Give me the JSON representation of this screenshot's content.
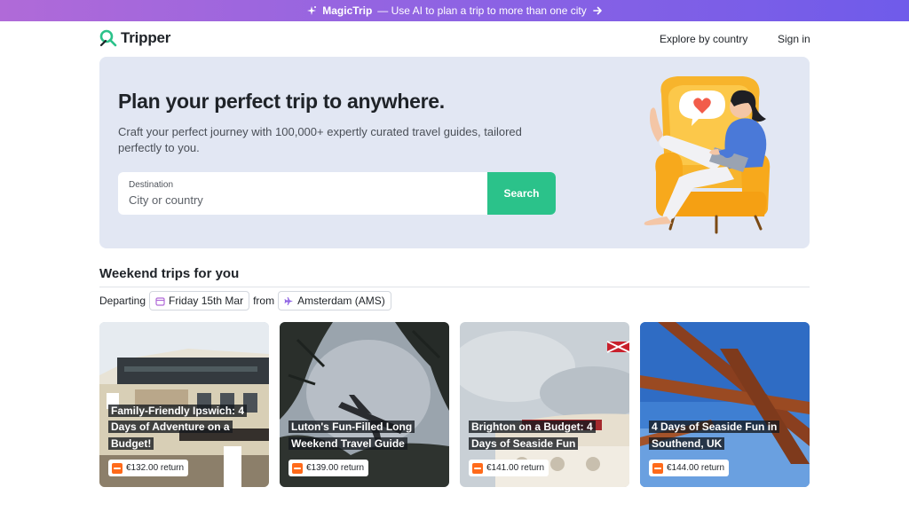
{
  "banner": {
    "brand": "MagicTrip",
    "text": "— Use AI to plan a trip to more than one city",
    "icon": "sparkle-icon",
    "arrow_icon": "arrow-right-icon"
  },
  "nav": {
    "logo": "Tripper",
    "explore": "Explore by country",
    "signin": "Sign in"
  },
  "hero": {
    "title": "Plan your perfect trip to anywhere.",
    "subtitle": "Craft your perfect journey with 100,000+ expertly curated travel guides, tailored perfectly to you.",
    "destination_label": "Destination",
    "destination_placeholder": "City or country",
    "search_button": "Search"
  },
  "weekend": {
    "title": "Weekend trips for you",
    "departing_label": "Departing",
    "date": "Friday 15th Mar",
    "from_label": "from",
    "origin": "Amsterdam (AMS)"
  },
  "cards": [
    {
      "title": "Family-Friendly Ipswich: 4 Days of Adventure on a Budget!",
      "price": "€132.00 return"
    },
    {
      "title": "Luton's Fun-Filled Long Weekend Travel Guide",
      "price": "€139.00 return"
    },
    {
      "title": "Brighton on a Budget: 4 Days of Seaside Fun",
      "price": "€141.00 return"
    },
    {
      "title": "4 Days of Seaside Fun in Southend, UK",
      "price": "€144.00 return"
    }
  ],
  "colors": {
    "accent_green": "#2bc28a",
    "banner_start": "#b06ad8",
    "banner_end": "#6f5bea",
    "hero_bg": "#e2e7f3",
    "price_icon": "#ff6a1a"
  }
}
